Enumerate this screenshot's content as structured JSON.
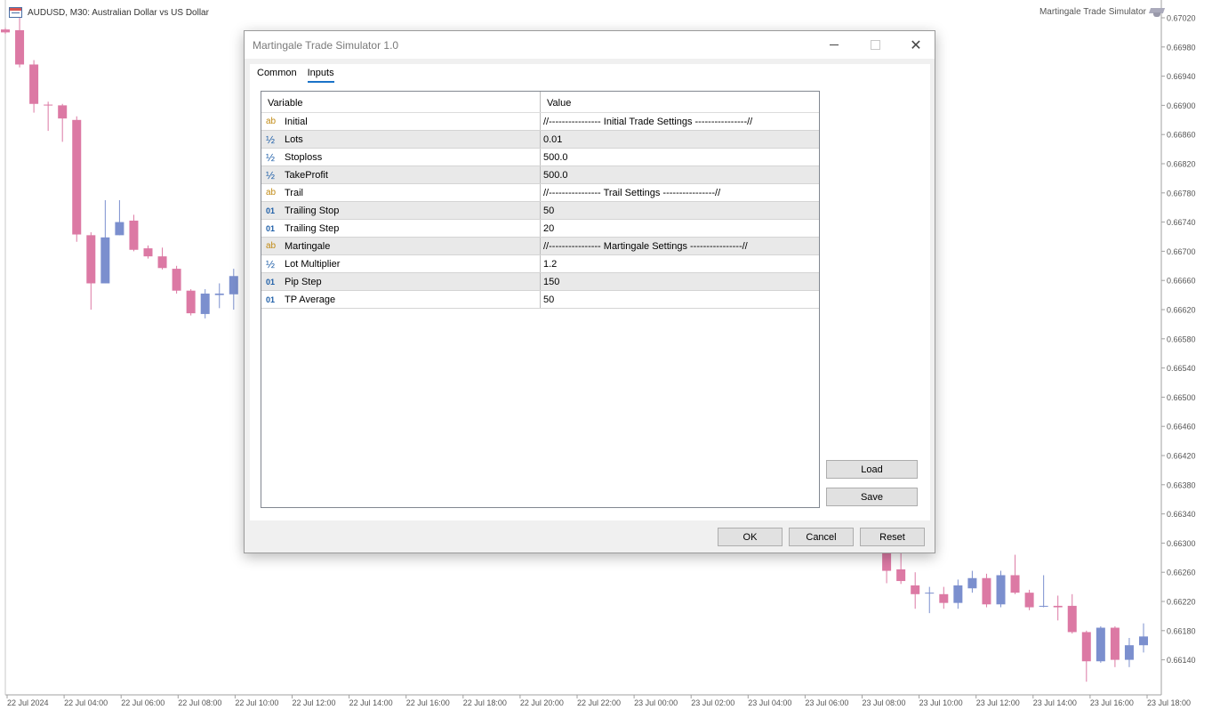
{
  "chart": {
    "symbol_text": "AUDUSD, M30:  Australian Dollar vs US Dollar",
    "ea_name": "Martingale Trade Simulator",
    "price_axis": [
      "0.67020",
      "0.66980",
      "0.66940",
      "0.66900",
      "0.66860",
      "0.66820",
      "0.66780",
      "0.66740",
      "0.66700",
      "0.66660",
      "0.66620",
      "0.66580",
      "0.66540",
      "0.66500",
      "0.66460",
      "0.66420",
      "0.66380",
      "0.66340",
      "0.66300",
      "0.66260",
      "0.66220",
      "0.66180",
      "0.66140"
    ],
    "time_axis": [
      "22 Jul 2024",
      "22 Jul 04:00",
      "22 Jul 06:00",
      "22 Jul 08:00",
      "22 Jul 10:00",
      "22 Jul 12:00",
      "22 Jul 14:00",
      "22 Jul 16:00",
      "22 Jul 18:00",
      "22 Jul 20:00",
      "22 Jul 22:00",
      "23 Jul 00:00",
      "23 Jul 02:00",
      "23 Jul 04:00",
      "23 Jul 06:00",
      "23 Jul 08:00",
      "23 Jul 10:00",
      "23 Jul 12:00",
      "23 Jul 14:00",
      "23 Jul 16:00",
      "23 Jul 18:00"
    ],
    "colors": {
      "bull": "#7b8fce",
      "bear": "#dc79a4",
      "axis": "#a0a0a0"
    },
    "candles_left": [
      {
        "o": 0.67004,
        "c": 0.67,
        "h": 0.67006,
        "l": 0.66998
      },
      {
        "o": 0.67003,
        "c": 0.66956,
        "h": 0.6702,
        "l": 0.66952
      },
      {
        "o": 0.66956,
        "c": 0.66902,
        "h": 0.66962,
        "l": 0.6689
      },
      {
        "o": 0.66901,
        "c": 0.669,
        "h": 0.66905,
        "l": 0.66865
      },
      {
        "o": 0.669,
        "c": 0.66882,
        "h": 0.66902,
        "l": 0.6685
      },
      {
        "o": 0.6688,
        "c": 0.66723,
        "h": 0.66885,
        "l": 0.66713
      },
      {
        "o": 0.66722,
        "c": 0.66656,
        "h": 0.66726,
        "l": 0.6662
      },
      {
        "o": 0.66656,
        "c": 0.66719,
        "h": 0.6677,
        "l": 0.66656
      },
      {
        "o": 0.66722,
        "c": 0.6674,
        "h": 0.6677,
        "l": 0.66722
      },
      {
        "o": 0.66742,
        "c": 0.66702,
        "h": 0.6675,
        "l": 0.667
      },
      {
        "o": 0.66704,
        "c": 0.66693,
        "h": 0.66708,
        "l": 0.6669
      },
      {
        "o": 0.66693,
        "c": 0.66677,
        "h": 0.66705,
        "l": 0.66675
      },
      {
        "o": 0.66676,
        "c": 0.66646,
        "h": 0.6668,
        "l": 0.66642
      },
      {
        "o": 0.66646,
        "c": 0.66615,
        "h": 0.66648,
        "l": 0.66612
      },
      {
        "o": 0.66614,
        "c": 0.66642,
        "h": 0.66648,
        "l": 0.66608
      },
      {
        "o": 0.6664,
        "c": 0.66642,
        "h": 0.66656,
        "l": 0.66622
      },
      {
        "o": 0.66641,
        "c": 0.66666,
        "h": 0.66676,
        "l": 0.6662
      }
    ],
    "candles_right": [
      {
        "o": 0.663,
        "c": 0.66298,
        "h": 0.66304,
        "l": 0.66296
      },
      {
        "o": 0.663,
        "c": 0.66296,
        "h": 0.66304,
        "l": 0.66292
      },
      {
        "o": 0.66292,
        "c": 0.66262,
        "h": 0.66294,
        "l": 0.66245
      },
      {
        "o": 0.66264,
        "c": 0.66248,
        "h": 0.66286,
        "l": 0.66244
      },
      {
        "o": 0.66242,
        "c": 0.6623,
        "h": 0.6626,
        "l": 0.6621
      },
      {
        "o": 0.66232,
        "c": 0.66232,
        "h": 0.6624,
        "l": 0.66204
      },
      {
        "o": 0.6623,
        "c": 0.66218,
        "h": 0.6624,
        "l": 0.6621
      },
      {
        "o": 0.66218,
        "c": 0.66242,
        "h": 0.6625,
        "l": 0.6621
      },
      {
        "o": 0.66238,
        "c": 0.66252,
        "h": 0.66262,
        "l": 0.66232
      },
      {
        "o": 0.66252,
        "c": 0.66216,
        "h": 0.66258,
        "l": 0.66212
      },
      {
        "o": 0.66216,
        "c": 0.66256,
        "h": 0.66262,
        "l": 0.66212
      },
      {
        "o": 0.66256,
        "c": 0.66232,
        "h": 0.66284,
        "l": 0.6623
      },
      {
        "o": 0.66232,
        "c": 0.66212,
        "h": 0.66236,
        "l": 0.66208
      },
      {
        "o": 0.66214,
        "c": 0.66214,
        "h": 0.66256,
        "l": 0.66212
      },
      {
        "o": 0.66214,
        "c": 0.66212,
        "h": 0.66228,
        "l": 0.66194
      },
      {
        "o": 0.66214,
        "c": 0.66178,
        "h": 0.6623,
        "l": 0.66176
      },
      {
        "o": 0.66178,
        "c": 0.66138,
        "h": 0.6618,
        "l": 0.6611
      },
      {
        "o": 0.66138,
        "c": 0.66184,
        "h": 0.66186,
        "l": 0.66136
      },
      {
        "o": 0.66184,
        "c": 0.6614,
        "h": 0.66186,
        "l": 0.6613
      },
      {
        "o": 0.6614,
        "c": 0.6616,
        "h": 0.6617,
        "l": 0.6613
      },
      {
        "o": 0.6616,
        "c": 0.66172,
        "h": 0.6619,
        "l": 0.6615
      }
    ]
  },
  "dialog": {
    "title": "Martingale Trade Simulator 1.0",
    "tabs": [
      {
        "label": "Common"
      },
      {
        "label": "Inputs"
      }
    ],
    "grid": {
      "headers": {
        "variable": "Variable",
        "value": "Value"
      },
      "rows": [
        {
          "type": "ab",
          "type_icon": "text-type-icon",
          "variable": "Initial",
          "value": "//---------------- Initial Trade Settings ----------------//"
        },
        {
          "type": "½",
          "type_icon": "double-type-icon",
          "variable": "Lots",
          "value": "0.01"
        },
        {
          "type": "½",
          "type_icon": "double-type-icon",
          "variable": "Stoploss",
          "value": "500.0"
        },
        {
          "type": "½",
          "type_icon": "double-type-icon",
          "variable": "TakeProfit",
          "value": "500.0"
        },
        {
          "type": "ab",
          "type_icon": "text-type-icon",
          "variable": "Trail",
          "value": "//---------------- Trail Settings ----------------//"
        },
        {
          "type": "01",
          "type_icon": "integer-type-icon",
          "variable": "Trailing Stop",
          "value": "50"
        },
        {
          "type": "01",
          "type_icon": "integer-type-icon",
          "variable": "Trailing Step",
          "value": "20"
        },
        {
          "type": "ab",
          "type_icon": "text-type-icon",
          "variable": "Martingale",
          "value": "//---------------- Martingale Settings ----------------//"
        },
        {
          "type": "½",
          "type_icon": "double-type-icon",
          "variable": "Lot Multiplier",
          "value": "1.2"
        },
        {
          "type": "01",
          "type_icon": "integer-type-icon",
          "variable": "Pip Step",
          "value": "150"
        },
        {
          "type": "01",
          "type_icon": "integer-type-icon",
          "variable": "TP Average",
          "value": "50"
        }
      ]
    },
    "buttons": {
      "load": "Load",
      "save": "Save",
      "ok": "OK",
      "cancel": "Cancel",
      "reset": "Reset"
    }
  }
}
